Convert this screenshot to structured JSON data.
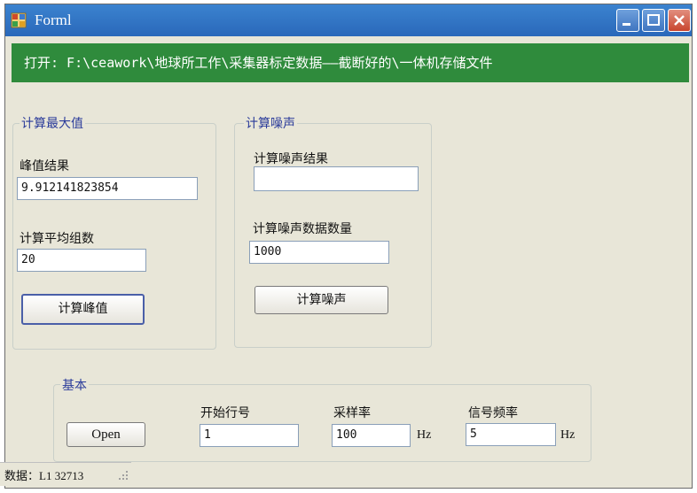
{
  "window": {
    "title": "Forml"
  },
  "banner": {
    "text": "打开: F:\\ceawork\\地球所工作\\采集器标定数据——截断好的\\一体机存储文件"
  },
  "peak_group": {
    "legend": "计算最大值",
    "result_label": "峰值结果",
    "result_value": "9.912141823854",
    "avg_label": "计算平均组数",
    "avg_value": "20",
    "button_label": "计算峰值"
  },
  "noise_group": {
    "legend": "计算噪声",
    "result_label": "计算噪声结果",
    "result_value": "",
    "count_label": "计算噪声数据数量",
    "count_value": "1000",
    "button_label": "计算噪声"
  },
  "basic_group": {
    "legend": "基本",
    "open_label": "Open",
    "start_row_label": "开始行号",
    "start_row_value": "1",
    "sample_rate_label": "采样率",
    "sample_rate_value": "100",
    "sample_rate_unit": "Hz",
    "signal_freq_label": "信号频率",
    "signal_freq_value": "5",
    "signal_freq_unit": "Hz"
  },
  "status": {
    "text": "数据：L1 32713"
  },
  "colors": {
    "titlebar": "#2a68ba",
    "banner": "#2f8b3c",
    "legend": "#2a3b9a"
  }
}
